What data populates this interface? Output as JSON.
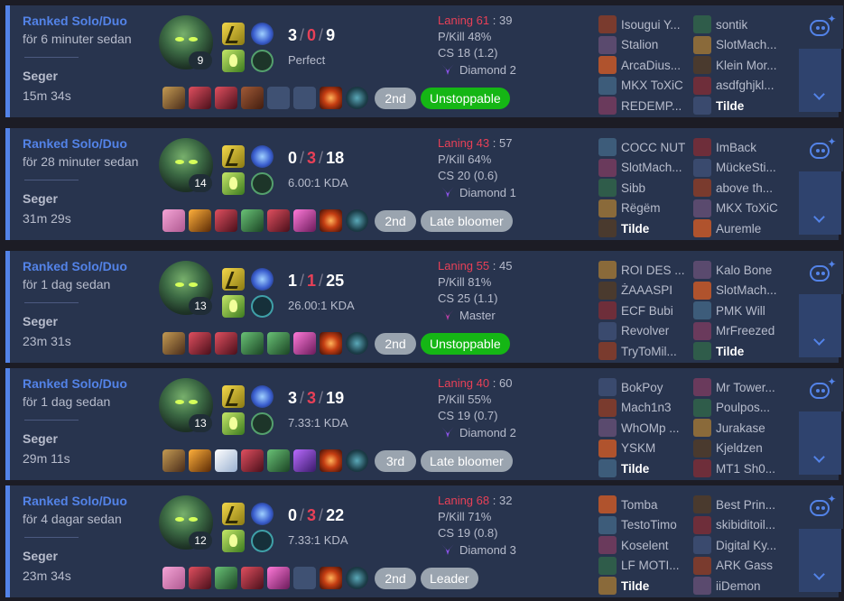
{
  "colors": {
    "accent": "#5383e8",
    "card_bg": "#28344e",
    "page_bg": "#1c1c25",
    "death_red": "#e84057",
    "tag_green": "#15b615",
    "tag_gray": "#9aa4af"
  },
  "matches": [
    {
      "queue": "Ranked Solo/Duo",
      "time_ago": "för 6 minuter sedan",
      "result": "Seger",
      "duration": "15m 34s",
      "champion_level": "9",
      "kills": "3",
      "deaths": "0",
      "assists": "9",
      "kda_text": "Perfect",
      "spells": [
        "flash-spell",
        "exhaust-spell"
      ],
      "runes": [
        "primary-rune",
        "secondary-rune"
      ],
      "items": [
        "blade",
        "crimson",
        "crimson",
        "book",
        "empty",
        "empty",
        "ward",
        "lens"
      ],
      "placement": "2nd",
      "tag": "Unstoppable",
      "tag_color": "green",
      "laning_label": "Laning 61",
      "laning_opp": "39",
      "p_kill": "P/Kill 48%",
      "cs": "CS 18 (1.2)",
      "rank": "Diamond 2",
      "rank_icon": "diamond",
      "team_a": [
        "Isougui Y...",
        "Stalion",
        "ArcaDius...",
        "MKX ToXiC",
        "REDEMP..."
      ],
      "team_b": [
        "sontik",
        "SlotMach...",
        "Klein Mor...",
        "asdfghjkl...",
        "Tilde"
      ],
      "me_team": "b",
      "me_index": 4
    },
    {
      "queue": "Ranked Solo/Duo",
      "time_ago": "för 28 minuter sedan",
      "result": "Seger",
      "duration": "31m 29s",
      "champion_level": "14",
      "kills": "0",
      "deaths": "3",
      "assists": "18",
      "kda_text": "6.00:1 KDA",
      "spells": [
        "flash-spell",
        "ignite-spell"
      ],
      "runes": [
        "primary-rune",
        "secondary-rune"
      ],
      "items": [
        "cat",
        "bell",
        "crimson",
        "green",
        "crimson",
        "pink",
        "ward",
        "lens"
      ],
      "placement": "2nd",
      "tag": "Late bloomer",
      "tag_color": "gray",
      "laning_label": "Laning 43",
      "laning_opp": "57",
      "p_kill": "P/Kill 64%",
      "cs": "CS 20 (0.6)",
      "rank": "Diamond 1",
      "rank_icon": "diamond",
      "team_a": [
        "COCC NUT",
        "SlotMach...",
        "Sibb",
        "Rëgëm",
        "Tilde"
      ],
      "team_b": [
        "ImBack",
        "MückeSti...",
        "above th...",
        "MKX ToXiC",
        "Auremle"
      ],
      "me_team": "a",
      "me_index": 4
    },
    {
      "queue": "Ranked Solo/Duo",
      "time_ago": "för 1 dag sedan",
      "result": "Seger",
      "duration": "23m 31s",
      "champion_level": "13",
      "kills": "1",
      "deaths": "1",
      "assists": "25",
      "kda_text": "26.00:1 KDA",
      "spells": [
        "flash-spell",
        "ignite-spell"
      ],
      "runes": [
        "primary-rune",
        "secondary-rune-alt"
      ],
      "items": [
        "blade",
        "crimson",
        "crimson",
        "green",
        "green",
        "pink",
        "ward",
        "lens"
      ],
      "placement": "2nd",
      "tag": "Unstoppable",
      "tag_color": "green",
      "laning_label": "Laning 55",
      "laning_opp": "45",
      "p_kill": "P/Kill 81%",
      "cs": "CS 25 (1.1)",
      "rank": "Master",
      "rank_icon": "master",
      "team_a": [
        "ROI DES ...",
        "ŻAAASPI",
        "ECF Bubi",
        "Revolver",
        "TryToMil..."
      ],
      "team_b": [
        "Kalo Bone",
        "SlotMach...",
        "PMK Will",
        "MrFreezed",
        "Tilde"
      ],
      "me_team": "b",
      "me_index": 4
    },
    {
      "queue": "Ranked Solo/Duo",
      "time_ago": "för 1 dag sedan",
      "result": "Seger",
      "duration": "29m 11s",
      "champion_level": "13",
      "kills": "3",
      "deaths": "3",
      "assists": "19",
      "kda_text": "7.33:1 KDA",
      "spells": [
        "flash-spell",
        "ignite-spell"
      ],
      "runes": [
        "primary-rune",
        "secondary-rune"
      ],
      "items": [
        "blade",
        "bell",
        "bird",
        "crimson",
        "green",
        "violet",
        "ward",
        "lens"
      ],
      "placement": "3rd",
      "tag": "Late bloomer",
      "tag_color": "gray",
      "laning_label": "Laning 40",
      "laning_opp": "60",
      "p_kill": "P/Kill 55%",
      "cs": "CS 19 (0.7)",
      "rank": "Diamond 2",
      "rank_icon": "diamond",
      "team_a": [
        "BokPoy",
        "Mach1n3",
        "WhOMp ...",
        "YSKM",
        "Tilde"
      ],
      "team_b": [
        "Mr Tower...",
        "Poulpos...",
        "Jurakase",
        "Kjeldzen",
        "MT1 Sh0..."
      ],
      "me_team": "a",
      "me_index": 4
    },
    {
      "queue": "Ranked Solo/Duo",
      "time_ago": "för 4 dagar sedan",
      "result": "Seger",
      "duration": "23m 34s",
      "champion_level": "12",
      "kills": "0",
      "deaths": "3",
      "assists": "22",
      "kda_text": "7.33:1 KDA",
      "spells": [
        "flash-spell",
        "ignite-spell"
      ],
      "runes": [
        "primary-rune",
        "secondary-rune-alt"
      ],
      "items": [
        "cat",
        "crimson",
        "green",
        "crimson",
        "pink",
        "empty",
        "ward",
        "lens"
      ],
      "placement": "2nd",
      "tag": "Leader",
      "tag_color": "gray",
      "laning_label": "Laning 68",
      "laning_opp": "32",
      "p_kill": "P/Kill 71%",
      "cs": "CS 19 (0.8)",
      "rank": "Diamond 3",
      "rank_icon": "diamond",
      "team_a": [
        "Tomba",
        "TestoTimo",
        "Koselent",
        "LF MOTI...",
        "Tilde"
      ],
      "team_b": [
        "Best Prin...",
        "skibiditoil...",
        "Digital Ky...",
        "ARK Gass",
        "iiDemon"
      ],
      "me_team": "a",
      "me_index": 4
    }
  ]
}
